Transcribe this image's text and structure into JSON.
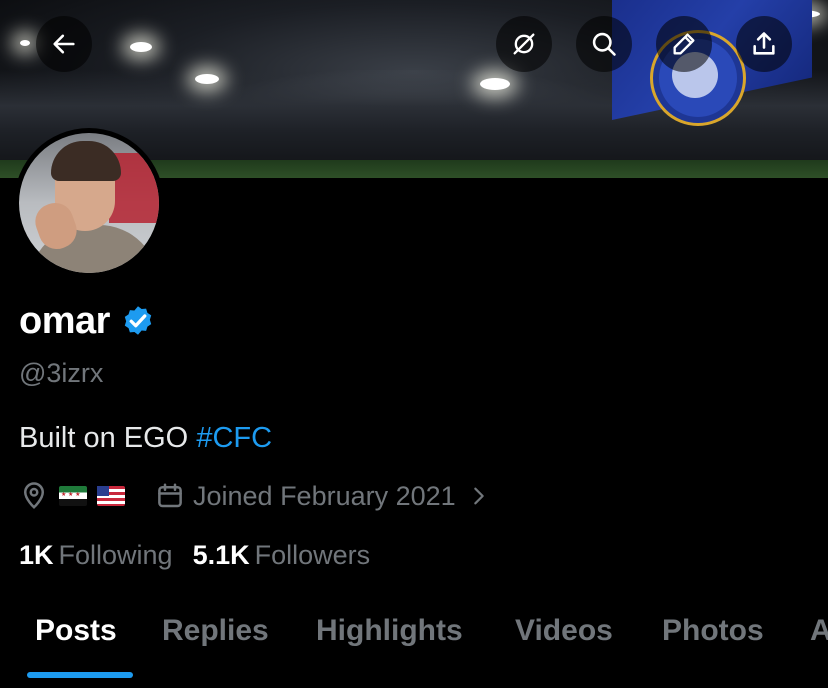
{
  "header": {
    "back_icon": "arrow-left-icon",
    "actions": [
      {
        "name": "grok-icon"
      },
      {
        "name": "search-icon"
      },
      {
        "name": "edit-icon"
      },
      {
        "name": "share-icon"
      }
    ]
  },
  "profile": {
    "name": "omar",
    "verified": true,
    "handle": "@3izrx",
    "bio_text": "Built on EGO ",
    "bio_hashtag": "#CFC",
    "location_flags": [
      "🇸🇾",
      "🇺🇸"
    ],
    "joined": "Joined February 2021",
    "following_count": "1K",
    "following_label": "Following",
    "followers_count": "5.1K",
    "followers_label": "Followers"
  },
  "tabs": [
    {
      "label": "Posts",
      "active": true
    },
    {
      "label": "Replies"
    },
    {
      "label": "Highlights"
    },
    {
      "label": "Videos"
    },
    {
      "label": "Photos"
    },
    {
      "label": "A"
    }
  ],
  "colors": {
    "background": "#000000",
    "accent": "#1d9bf0",
    "secondary_text": "#71767b",
    "primary_text": "#e7e9ea"
  }
}
